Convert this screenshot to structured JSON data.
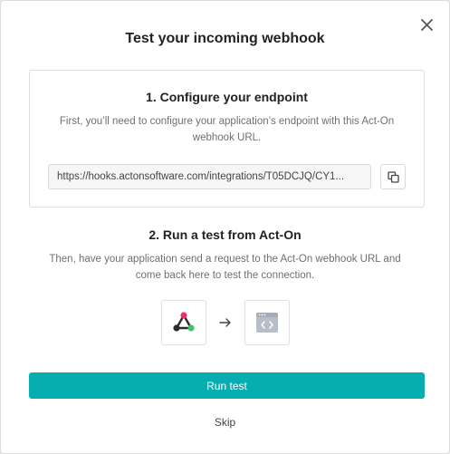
{
  "dialog": {
    "title": "Test your incoming webhook",
    "close_icon": "close-icon"
  },
  "step1": {
    "title": "1. Configure your endpoint",
    "description": "First, you’ll need to configure your application’s endpoint with this Act-On webhook URL.",
    "url": "https://hooks.actonsoftware.com/integrations/T05DCJQ/CY1...",
    "copy_icon": "copy-icon"
  },
  "step2": {
    "title": "2. Run a test from Act-On",
    "description": "Then, have your application send a request to the Act-On webhook URL and come back here to test the connection.",
    "source_icon": "webhook-icon",
    "arrow_icon": "arrow-right-icon",
    "target_icon": "code-window-icon"
  },
  "actions": {
    "run_label": "Run test",
    "skip_label": "Skip"
  },
  "colors": {
    "accent": "#06aeb2",
    "webhook_pink": "#e7346f",
    "webhook_green": "#3fc36b",
    "webhook_dark": "#2b2b2b",
    "icon_gray": "#b8bec7"
  }
}
